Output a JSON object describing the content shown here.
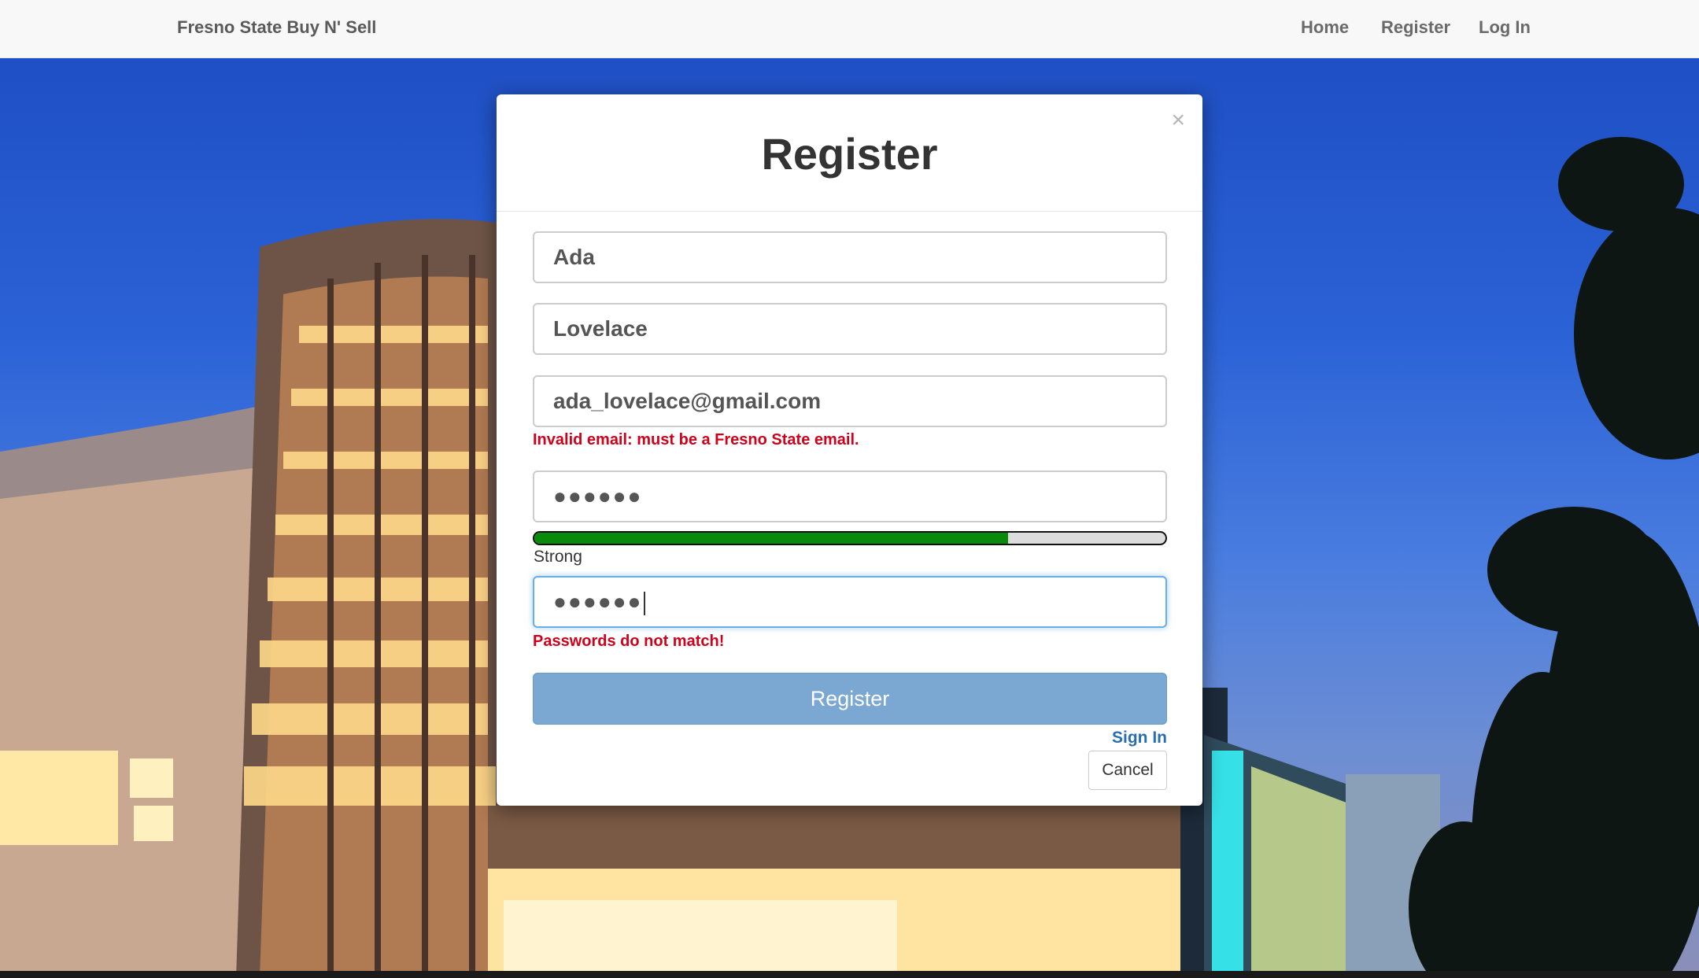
{
  "navbar": {
    "brand": "Fresno State Buy N' Sell",
    "links": {
      "home": "Home",
      "register": "Register",
      "login": "Log In"
    }
  },
  "modal": {
    "title": "Register",
    "close_icon": "×",
    "first_name": "Ada",
    "last_name": "Lovelace",
    "email": "ada_lovelace@gmail.com",
    "email_error": "Invalid email: must be a Fresno State email.",
    "password_mask": "●●●●●●",
    "strength": {
      "label": "Strong",
      "level_percent": 75,
      "color": "#0a8a0a"
    },
    "confirm_mask": "●●●●●●",
    "confirm_error": "Passwords do not match!",
    "submit_label": "Register",
    "signin_label": "Sign In",
    "cancel_label": "Cancel"
  }
}
